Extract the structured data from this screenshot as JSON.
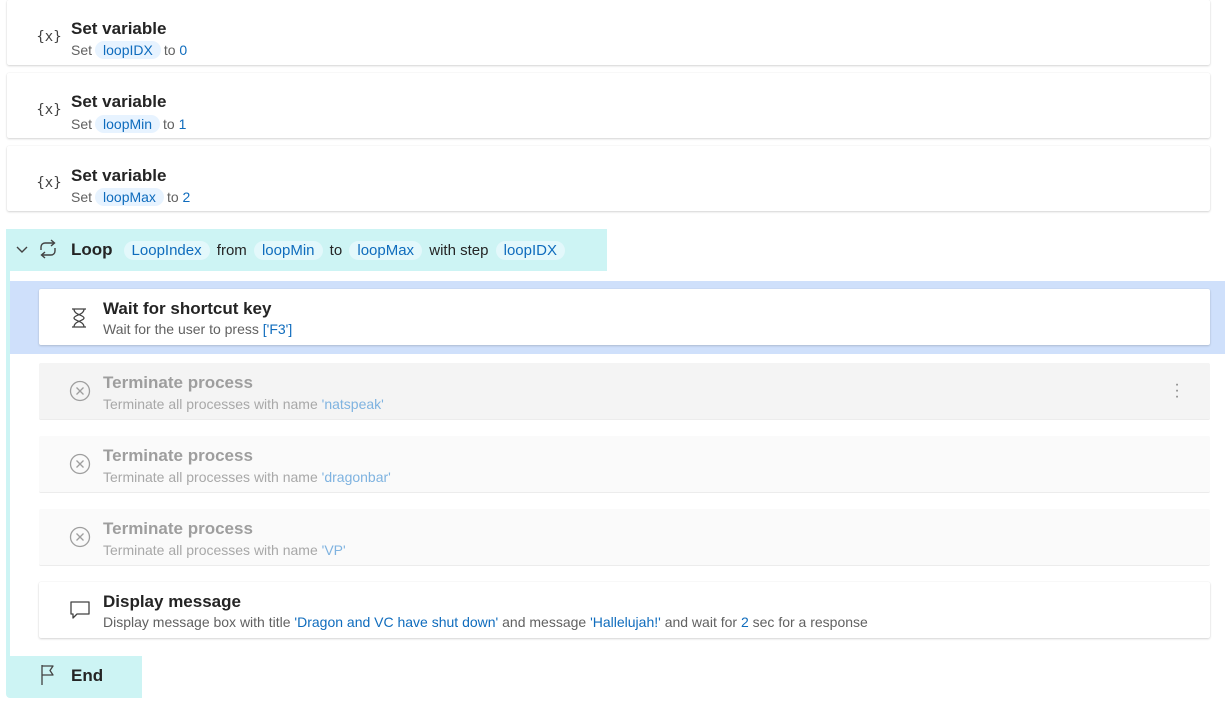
{
  "steps": [
    {
      "title": "Set variable",
      "set_label": "Set",
      "var": "loopIDX",
      "to_label": "to",
      "value": "0"
    },
    {
      "title": "Set variable",
      "set_label": "Set",
      "var": "loopMin",
      "to_label": "to",
      "value": "1"
    },
    {
      "title": "Set variable",
      "set_label": "Set",
      "var": "loopMax",
      "to_label": "to",
      "value": "2"
    }
  ],
  "var_icon_text": "{x}",
  "loop": {
    "keyword": "Loop",
    "index_var": "LoopIndex",
    "from_label": "from",
    "from_var": "loopMin",
    "to_label": "to",
    "to_var": "loopMax",
    "step_label": "with step",
    "step_var": "loopIDX"
  },
  "wait": {
    "title": "Wait for shortcut key",
    "desc": "Wait for the user to press",
    "value": "['F3']"
  },
  "terminate": [
    {
      "title": "Terminate process",
      "desc": "Terminate all processes with name",
      "value": "'natspeak'"
    },
    {
      "title": "Terminate process",
      "desc": "Terminate all processes with name",
      "value": "'dragonbar'"
    },
    {
      "title": "Terminate process",
      "desc": "Terminate all processes with name",
      "value": "'VP'"
    }
  ],
  "display": {
    "title": "Display message",
    "desc_1": "Display message box with title",
    "msg_title": "'Dragon and VC have shut down'",
    "desc_2": "and message",
    "message": "'Hallelujah!'",
    "desc_3": "and wait for",
    "seconds": "2",
    "desc_4": "sec for a response"
  },
  "end_label": "End",
  "colors": {
    "accent": "#0f6cbd",
    "loop_bg": "#cdf4f4",
    "selection": "#cfe0fb"
  },
  "icons": [
    "variable-icon",
    "loop-icon",
    "chevron-down-icon",
    "hourglass-icon",
    "close-circle-icon",
    "message-icon",
    "flag-icon",
    "more-vertical-icon"
  ]
}
